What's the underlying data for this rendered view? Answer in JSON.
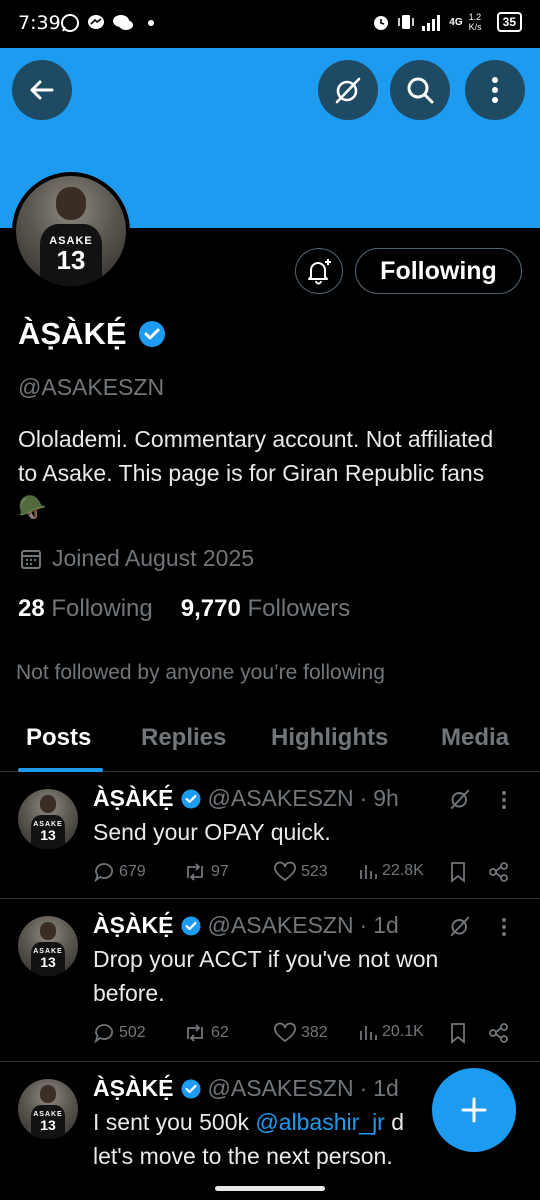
{
  "status_bar": {
    "time": "7:39",
    "network": "4G",
    "speed": "1.2 K/s",
    "battery": "35"
  },
  "header": {
    "back_icon": "arrow-left-icon",
    "grok_icon": "grok-icon",
    "search_icon": "search-icon",
    "more_icon": "more-vertical-icon",
    "banner_color": "#1d9bf0"
  },
  "profile": {
    "name": "ÀṢÀKẸ́",
    "handle": "@ASAKESZN",
    "bio": "Ololademi. Commentary account. Not affiliated to Asake. This page is for Giran Republic fans 🪖",
    "joined": "Joined August 2025",
    "following_count": "28",
    "following_label": "Following",
    "followers_count": "9,770",
    "followers_label": "Followers",
    "not_followed": "Not followed by anyone you’re following",
    "follow_button": "Following",
    "avatar_jersey_name": "ASAKE",
    "avatar_jersey_number": "13"
  },
  "tabs": [
    {
      "label": "Posts",
      "active": true
    },
    {
      "label": "Replies",
      "active": false
    },
    {
      "label": "Highlights",
      "active": false
    },
    {
      "label": "Media",
      "active": false
    }
  ],
  "posts": [
    {
      "name": "ÀṢÀKẸ́",
      "handle": "@ASAKESZN",
      "time": "9h",
      "text": "Send your OPAY quick.",
      "replies": "679",
      "reposts": "97",
      "likes": "523",
      "views": "22.8K"
    },
    {
      "name": "ÀṢÀKẸ́",
      "handle": "@ASAKESZN",
      "time": "1d",
      "text": "Drop your ACCT if you've not won before.",
      "replies": "502",
      "reposts": "62",
      "likes": "382",
      "views": "20.1K"
    },
    {
      "name": "ÀṢÀKẸ́",
      "handle": "@ASAKESZN",
      "time": "1d",
      "text_before": "I sent you 500k ",
      "mention": "@albashir_jr",
      "text_after": " d",
      "text_line2": "let's move to the next person."
    }
  ],
  "fab": {
    "icon": "plus-icon"
  },
  "colors": {
    "accent": "#1d9bf0",
    "muted": "#71767b",
    "background": "#000000"
  }
}
